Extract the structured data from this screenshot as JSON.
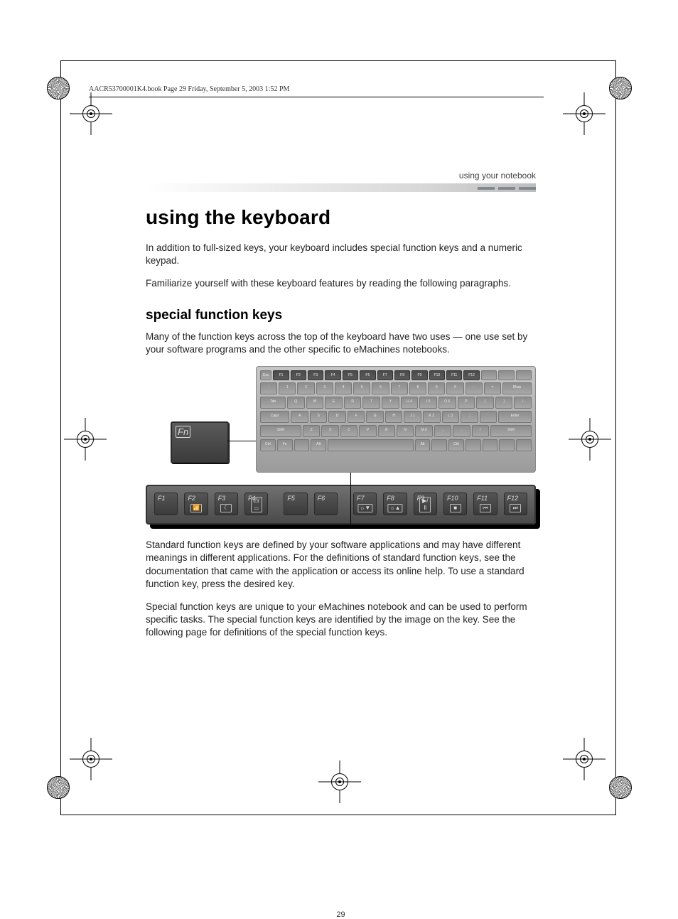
{
  "header_line": "AACR53700001K4.book  Page 29  Friday, September 5, 2003  1:52 PM",
  "running_head": "using your notebook",
  "h1": "using the keyboard",
  "p1": "In addition to full-sized keys, your keyboard includes special function keys and a numeric keypad.",
  "p2": "Familiarize yourself with these keyboard features by reading the following paragraphs.",
  "h2": "special function keys",
  "p3": "Many of the function keys across the top of the keyboard have two uses — one use set by your software programs and the other specific to eMachines notebooks.",
  "fn_label": "Fn",
  "kb_rows": {
    "fn": [
      "Esc",
      "F1",
      "F2",
      "F3",
      "F4",
      "F5",
      "F6",
      "F7",
      "F8",
      "F9",
      "F10",
      "F11",
      "F12",
      "",
      "",
      ""
    ],
    "num": [
      "`",
      "1",
      "2",
      "3",
      "4",
      "5",
      "6",
      "7",
      "8",
      "9",
      "0",
      "-",
      "=",
      "Bksp"
    ],
    "q": [
      "Tab",
      "Q",
      "W",
      "E",
      "R",
      "T",
      "Y",
      "U  4",
      "I  5",
      "O  6",
      "P",
      "[",
      "]",
      "\\"
    ],
    "a": [
      "Caps",
      "A",
      "S",
      "D",
      "F",
      "G",
      "H",
      "J  1",
      "K  2",
      "L  3",
      ";",
      "'",
      "Enter"
    ],
    "z": [
      "Shift",
      "Z",
      "X",
      "C",
      "V",
      "B",
      "N",
      "M  0",
      ",",
      ".",
      "/",
      "Shift"
    ],
    "sp": [
      "Ctrl",
      "Fn",
      "",
      "Alt",
      "",
      "Alt",
      "",
      "Ctrl",
      "",
      "",
      "",
      ""
    ]
  },
  "fstrip": [
    {
      "label": "F1",
      "icon": ""
    },
    {
      "label": "F2",
      "icon": "📶"
    },
    {
      "label": "F3",
      "icon": "☾"
    },
    {
      "label": "F4",
      "icon": "⎚/▭"
    },
    {
      "label": "F5",
      "icon": ""
    },
    {
      "label": "F6",
      "icon": ""
    },
    {
      "label": "F7",
      "icon": "☼▼"
    },
    {
      "label": "F8",
      "icon": "☼▲"
    },
    {
      "label": "F9",
      "icon": "▶/Ⅱ"
    },
    {
      "label": "F10",
      "icon": "■"
    },
    {
      "label": "F11",
      "icon": "⏮"
    },
    {
      "label": "F12",
      "icon": "⏭"
    }
  ],
  "p4": "Standard function keys are defined by your software applications and may have different meanings in different applications. For the definitions of standard function keys, see the documentation that came with the application or access its online help. To use a standard function key, press the desired key.",
  "p5": "Special function keys are unique to your eMachines notebook and can be used to perform specific tasks. The special function keys are identified by the image on the key. See the following page for definitions of the special function keys.",
  "page_no": "29"
}
